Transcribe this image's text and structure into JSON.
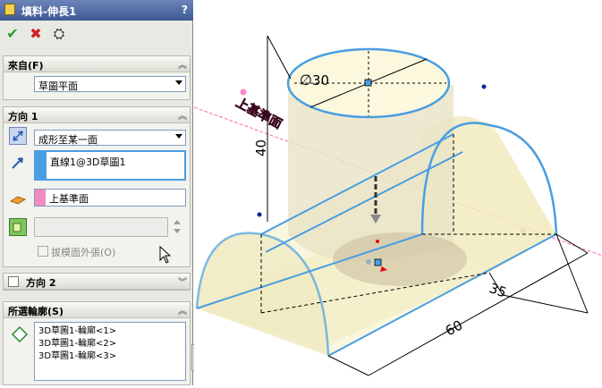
{
  "window": {
    "title": "填料-伸長1",
    "help": "?"
  },
  "actions": {
    "ok": "✔",
    "cancel": "✖",
    "preview": "⛭"
  },
  "from_group": {
    "title": "來自(F)",
    "value": "草圖平面"
  },
  "dir1_group": {
    "title": "方向 1",
    "end_condition": "成形至某一面",
    "direction_ref": "直線1@3D草圖1",
    "face_ref": "上基準面",
    "draft_label": "拔模面外張(O)"
  },
  "dir2_group": {
    "title": "方向 2"
  },
  "contours_group": {
    "title": "所選輪廓(S)",
    "items": [
      "3D草圖1-輪廓<1>",
      "3D草圖1-輪廓<2>",
      "3D草圖1-輪廓<3>"
    ]
  },
  "viewport": {
    "plane_label": "上基準面",
    "dim_diameter": "30",
    "dim_height": "40",
    "dim_width": "35",
    "dim_length": "60"
  },
  "colors": {
    "accent": "#4a9ee0",
    "sketch": "#ff69b4",
    "body": "#f3efbf"
  }
}
